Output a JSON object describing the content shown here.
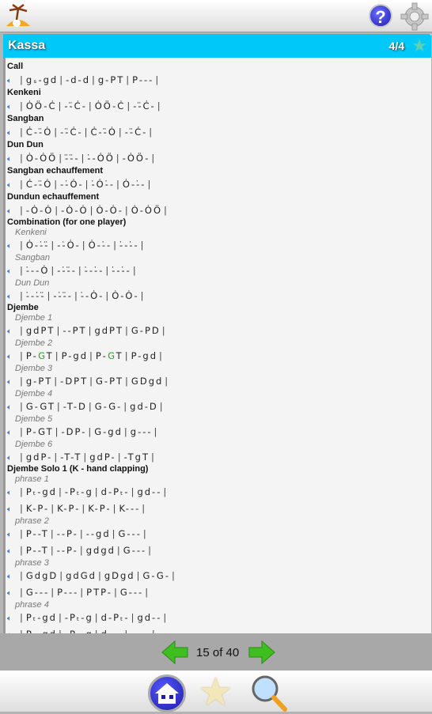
{
  "app": {
    "title": "Kassa",
    "counter": "4/4"
  },
  "icons": {
    "logo": "palm-tree-logo-icon",
    "help": "help-icon",
    "settings": "gear-icon",
    "favorite": "star-icon",
    "speaker": "speaker-icon",
    "prev": "arrow-left-icon",
    "next": "arrow-right-icon",
    "home": "home-icon",
    "search": "magnifier-icon"
  },
  "help_label": "?",
  "colors": {
    "titlebar": "#00c8f8",
    "accent_note": "#2aa02a",
    "nav_arrow": "#3fbf1f"
  },
  "items": [
    {
      "type": "title",
      "text": "Call"
    },
    {
      "type": "row",
      "measures": [
        "gₛ-gd",
        "-d-d",
        "g-PT",
        "P---"
      ]
    },
    {
      "type": "title",
      "text": "Kenkeni"
    },
    {
      "type": "row",
      "measures": [
        "ȮÖ-Ċ",
        "--̈Ċ-",
        "ȮÖ-Ċ",
        "--̈Ċ-"
      ]
    },
    {
      "type": "title",
      "text": "Sangban"
    },
    {
      "type": "row",
      "measures": [
        "Ċ--̈Ȯ",
        "--̈Ċ-",
        "Ċ--̈Ȯ",
        "--̈Ċ-"
      ]
    },
    {
      "type": "title",
      "text": "Dun Dun"
    },
    {
      "type": "row",
      "measures": [
        "Ȯ-ȮÖ",
        "-̈-̈-",
        "-̇-ȮÖ",
        "-ȮÖ-"
      ]
    },
    {
      "type": "title",
      "text": "Sangban echauffement"
    },
    {
      "type": "row",
      "measures": [
        "Ċ--̈Ȯ",
        "--̇Ȯ-",
        "-̇Ȯ-̇-",
        "Ȯ--̇-"
      ]
    },
    {
      "type": "title",
      "text": "Dundun echauffement"
    },
    {
      "type": "row",
      "measures": [
        "-Ȯ-Ȯ",
        "-Ȯ-Ȯ",
        "Ȯ-Ȯ-",
        "Ȯ-ȮÖ"
      ]
    },
    {
      "type": "group",
      "text": "Combination (for one player)"
    },
    {
      "type": "sub",
      "text": "Kenkeni"
    },
    {
      "type": "row",
      "measures": [
        "Ȯ--̇-̈",
        "--̇Ȯ-",
        "Ȯ--̇-",
        "-̇--̇-"
      ]
    },
    {
      "type": "sub",
      "text": "Sangban"
    },
    {
      "type": "row",
      "measures": [
        "-̇--Ȯ",
        "--̇-̈-",
        "-̇--̇-",
        "-̇--̇-"
      ]
    },
    {
      "type": "sub",
      "text": "Dun Dun"
    },
    {
      "type": "row",
      "measures": [
        "-̇--̇-̈",
        "--̇-̈-",
        "-̇-Ȯ-",
        "Ȯ-Ȯ-"
      ]
    },
    {
      "type": "group",
      "text": "Djembe"
    },
    {
      "type": "sub",
      "text": "Djembe 1"
    },
    {
      "type": "row",
      "measures": [
        "gdPT",
        "--PT",
        "gdPT",
        "G-PD"
      ]
    },
    {
      "type": "sub",
      "text": "Djembe 2"
    },
    {
      "type": "row",
      "measures": [
        "P-GT",
        "P-gd",
        "P-GT",
        "P-gd"
      ],
      "green_note": "G"
    },
    {
      "type": "sub",
      "text": "Djembe 3"
    },
    {
      "type": "row",
      "measures": [
        "g-PT",
        "-DPT",
        "G-PT",
        "GDgd"
      ]
    },
    {
      "type": "sub",
      "text": "Djembe 4"
    },
    {
      "type": "row",
      "measures": [
        "G-GT",
        "-T-D",
        "G-G-",
        "gd-D"
      ]
    },
    {
      "type": "sub",
      "text": "Djembe 5"
    },
    {
      "type": "row",
      "measures": [
        "P-GT",
        "-DP-",
        "G-gd",
        "g---"
      ]
    },
    {
      "type": "sub",
      "text": "Djembe 6"
    },
    {
      "type": "row",
      "measures": [
        "gdP-",
        "-T-T",
        "gdP-",
        "-TgT"
      ]
    },
    {
      "type": "group",
      "text": "Djembe Solo 1 (K - hand clapping)"
    },
    {
      "type": "sub",
      "text": "phrase 1"
    },
    {
      "type": "row",
      "measures": [
        "Pₜ-gd",
        "-Pₜ-g",
        "d-Pₜ-",
        "gd--"
      ]
    },
    {
      "type": "row2",
      "measures": [
        "K-P-",
        "K-P-",
        "K-P-",
        "K---"
      ]
    },
    {
      "type": "sub",
      "text": "phrase 2"
    },
    {
      "type": "row",
      "measures": [
        "P--T",
        "--P-",
        "--gd",
        "G---"
      ]
    },
    {
      "type": "row2",
      "measures": [
        "P--T",
        "--P-",
        "gdgd",
        "G---"
      ]
    },
    {
      "type": "sub",
      "text": "phrase 3"
    },
    {
      "type": "row",
      "measures": [
        "GdgD",
        "gdGd",
        "gDgd",
        "G-G-"
      ]
    },
    {
      "type": "row2",
      "measures": [
        "G---",
        "P---",
        "PTP-",
        "G---"
      ]
    },
    {
      "type": "sub",
      "text": "phrase 4"
    },
    {
      "type": "row",
      "measures": [
        "Pₜ-gd",
        "-Pₜ-g",
        "d-Pₜ-",
        "gd--"
      ]
    },
    {
      "type": "row2",
      "measures": [
        "Pₜ-gd",
        "-Pₜ-g",
        "d---",
        "----"
      ]
    }
  ],
  "pager": {
    "text": "15 of 40"
  }
}
